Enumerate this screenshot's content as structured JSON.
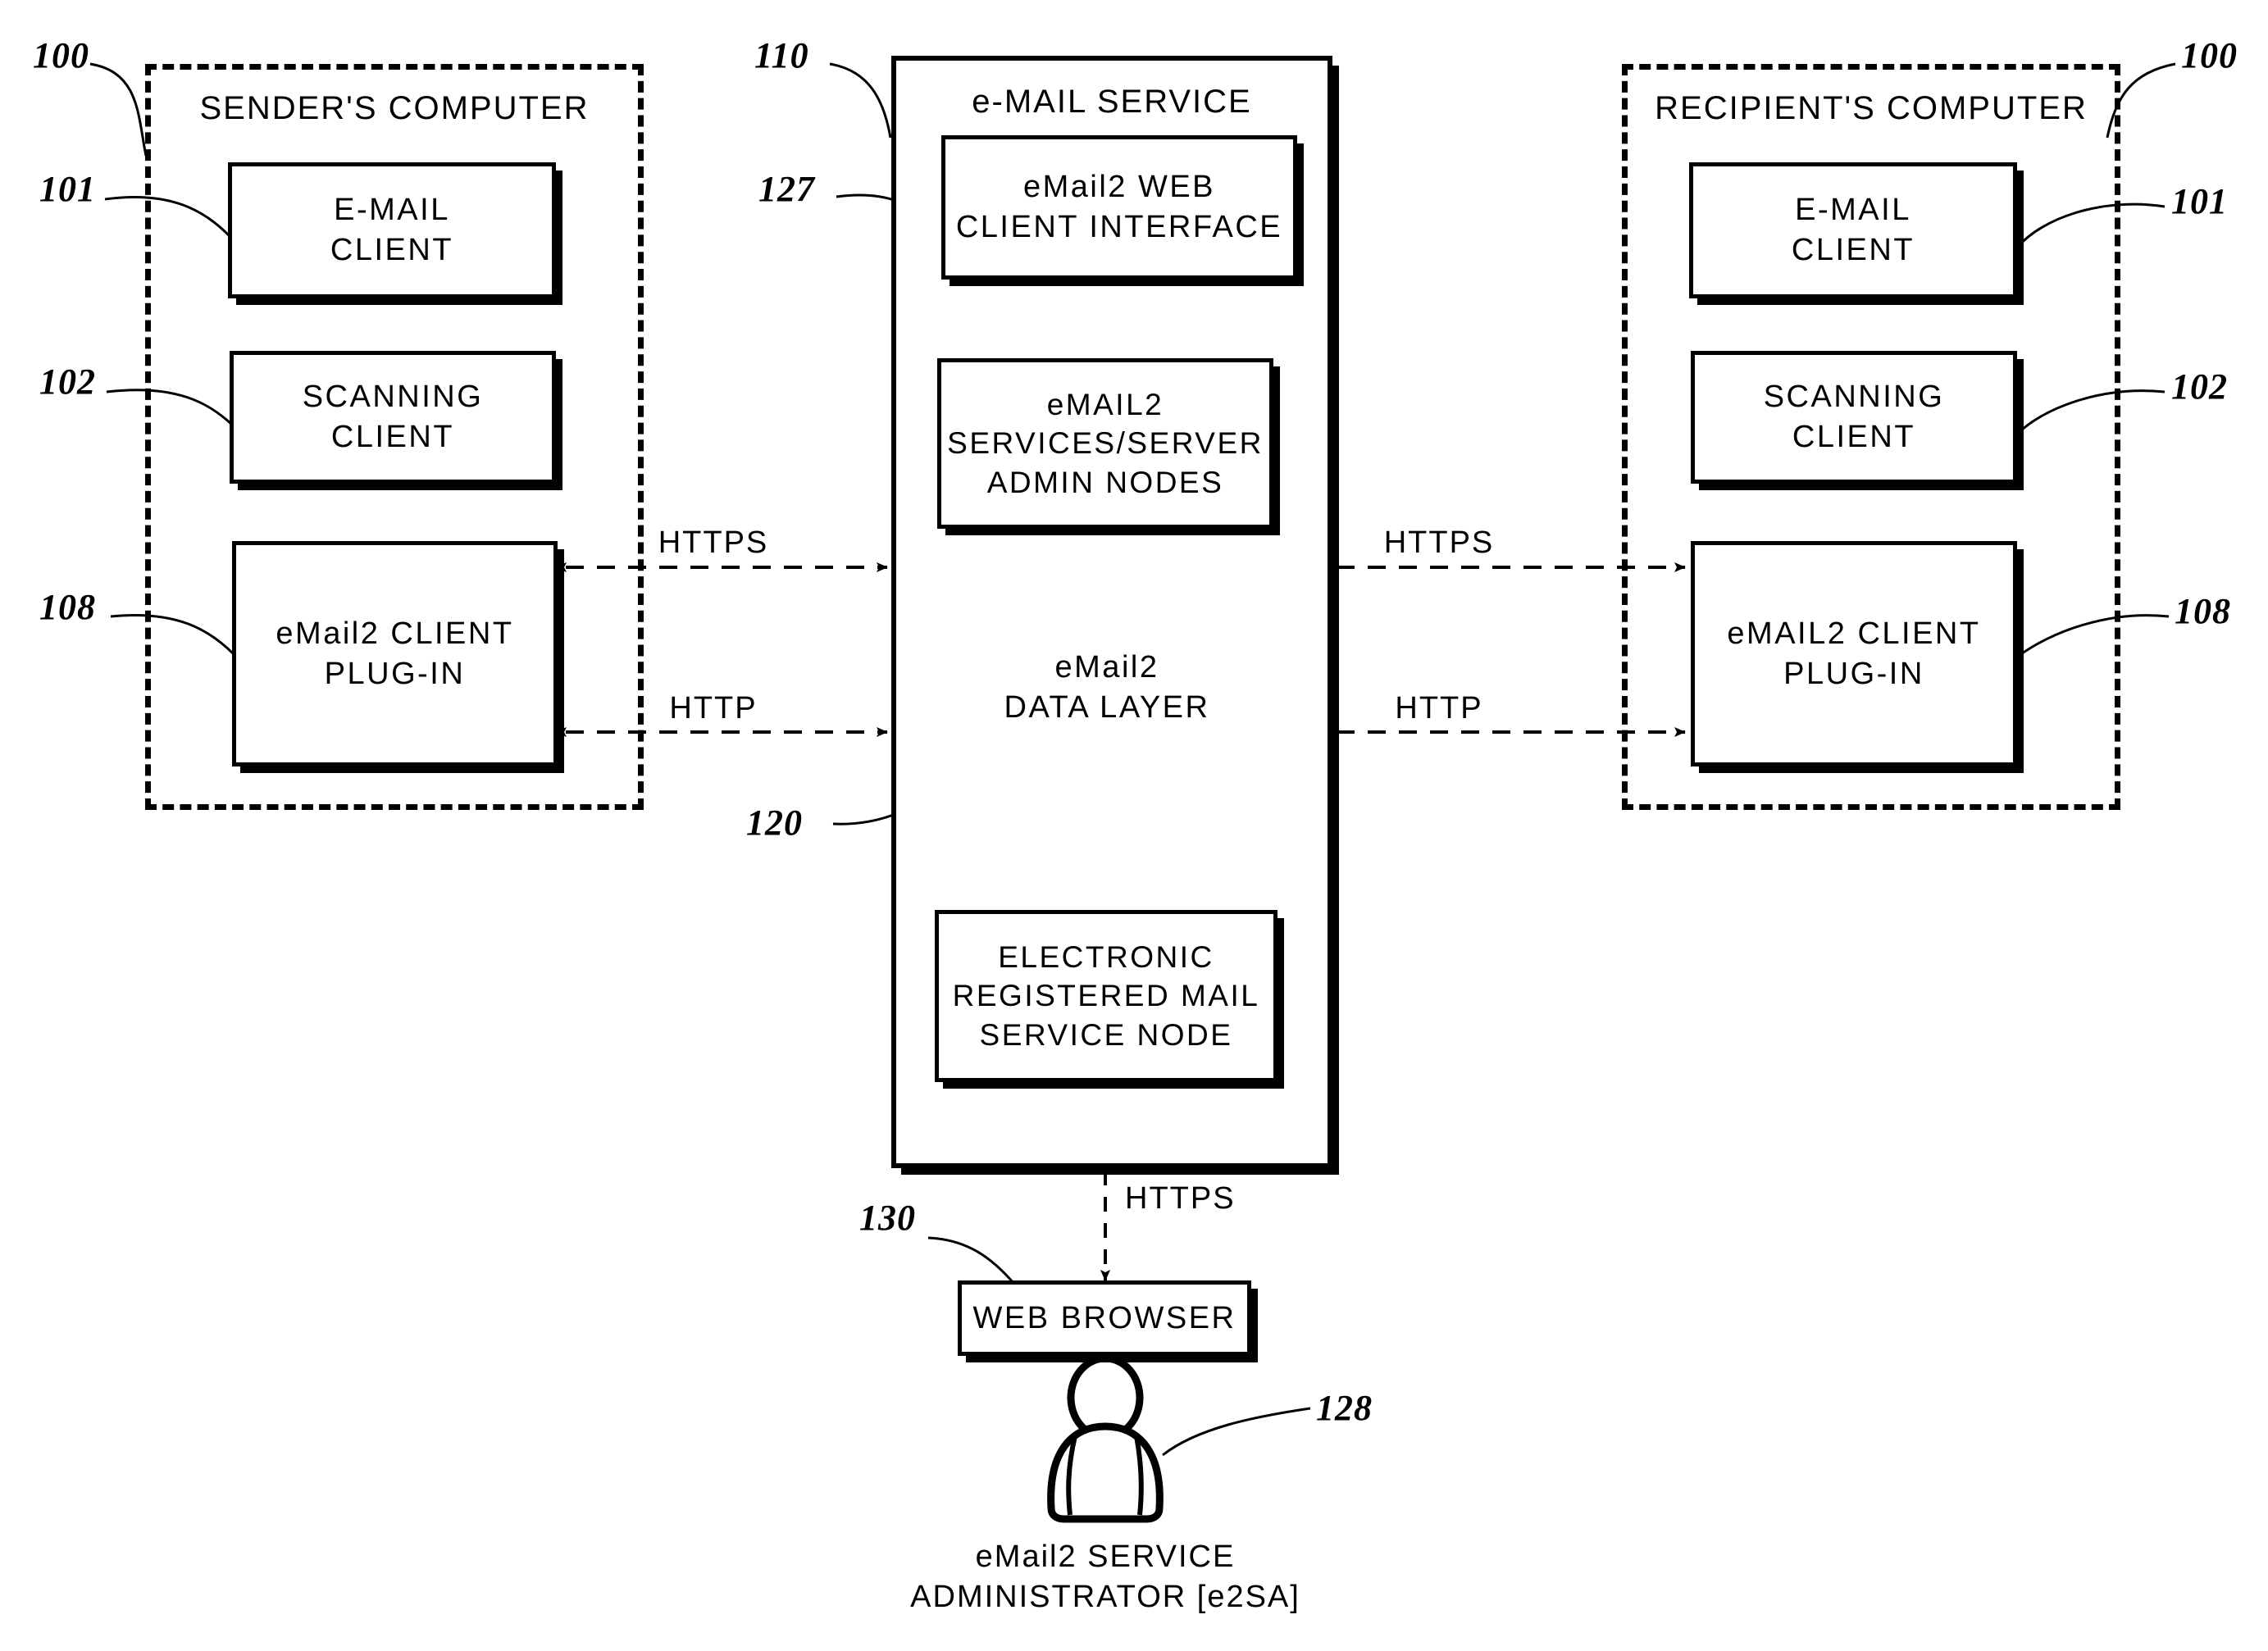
{
  "figure": {
    "type": "patent-block-diagram",
    "background": "#ffffff",
    "line_color": "#000000"
  },
  "sender": {
    "ref": "100",
    "title": "SENDER'S COMPUTER",
    "blocks": [
      {
        "ref": "101",
        "label": "E-MAIL\nCLIENT"
      },
      {
        "ref": "102",
        "label": "SCANNING\nCLIENT"
      },
      {
        "ref": "108",
        "label": "eMail2 CLIENT\nPLUG-IN"
      }
    ]
  },
  "recipient": {
    "ref": "100",
    "title": "RECIPIENT'S COMPUTER",
    "blocks": [
      {
        "ref": "101",
        "label": "E-MAIL\nCLIENT"
      },
      {
        "ref": "102",
        "label": "SCANNING\nCLIENT"
      },
      {
        "ref": "108",
        "label": "eMAIL2 CLIENT\nPLUG-IN"
      }
    ]
  },
  "service": {
    "ref": "110",
    "title": "e-MAIL SERVICE",
    "web_client": {
      "ref": "127",
      "label": "eMail2 WEB\nCLIENT INTERFACE"
    },
    "server_nodes": {
      "label": "eMAIL2\nSERVICES/SERVER\nADMIN NODES"
    },
    "data_layer": {
      "ref": "120",
      "label": "eMail2\nDATA LAYER"
    },
    "erm_node": {
      "label": "ELECTRONIC\nREGISTERED MAIL\nSERVICE NODE"
    }
  },
  "admin": {
    "browser": {
      "ref": "130",
      "label": "WEB BROWSER"
    },
    "actor": {
      "ref": "128",
      "label": "eMail2 SERVICE\nADMINISTRATOR [e2SA]"
    }
  },
  "connections": {
    "sender_https": "HTTPS",
    "sender_http": "HTTP",
    "recipient_https": "HTTPS",
    "recipient_http": "HTTP",
    "admin_https": "HTTPS"
  }
}
